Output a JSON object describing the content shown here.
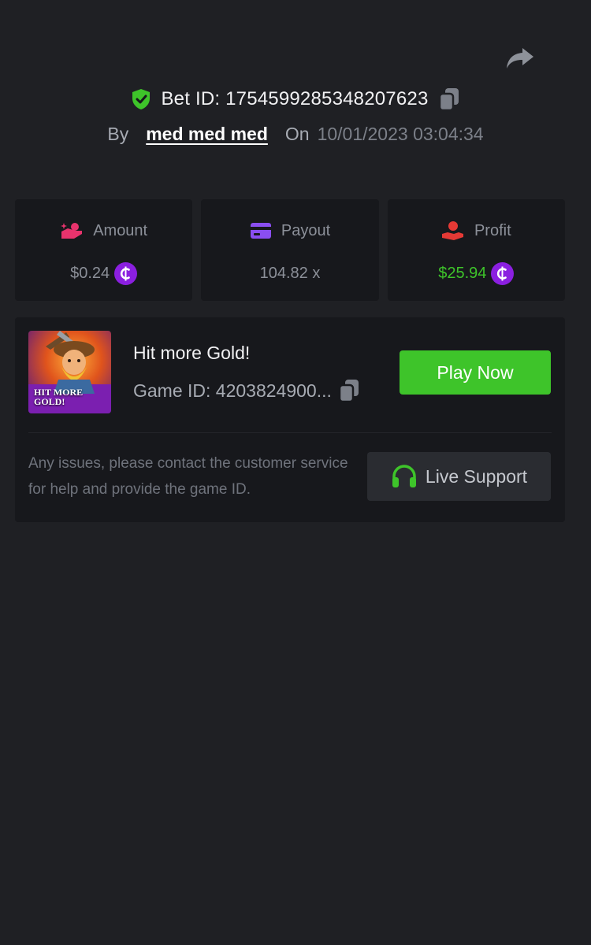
{
  "header": {
    "bet_id_text": "Bet ID: 1754599285348207623",
    "by_label": "By",
    "username": "med med med",
    "on_label": "On",
    "datetime": "10/01/2023 03:04:34"
  },
  "stats": [
    {
      "label": "Amount",
      "value": "$0.24",
      "icon": "coins-hand-icon",
      "currency_icon": "coin-c-icon"
    },
    {
      "label": "Payout",
      "value": "104.82 x",
      "icon": "credit-card-icon"
    },
    {
      "label": "Profit",
      "value": "$25.94",
      "icon": "hand-coin-icon",
      "currency_icon": "coin-c-icon"
    }
  ],
  "game": {
    "name": "Hit more Gold!",
    "id_text": "Game ID: 4203824900...",
    "play_label": "Play Now",
    "thumb_line1": "HIT MORE",
    "thumb_line2": "GOLD!"
  },
  "support": {
    "help_text": "Any issues, please contact the customer service for help and provide the game ID.",
    "button_label": "Live Support"
  },
  "colors": {
    "background": "#1f2024",
    "card": "#17181c",
    "green": "#3ec42a",
    "coin_purple": "#8b1fe0",
    "amount_pink": "#e8336d",
    "payout_purple": "#8a4ef0",
    "profit_red": "#e53935"
  }
}
